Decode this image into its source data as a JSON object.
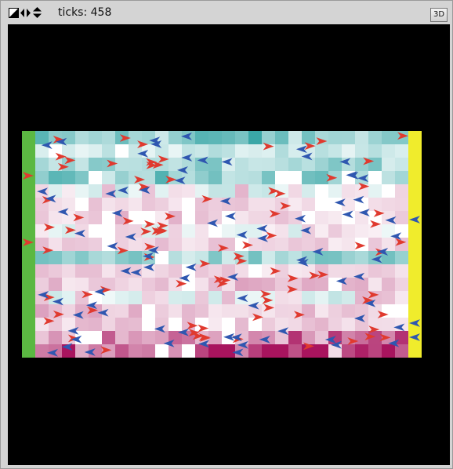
{
  "toolbar": {
    "ticks_text": "ticks: 458",
    "view_3d_label": "3D"
  },
  "icons": {
    "corner": "resize-corner-icon",
    "lr": "left-right-arrows-icon",
    "ud": "up-down-arrows-icon"
  },
  "colors": {
    "background": "#000000",
    "left_exit": "#5bb842",
    "right_exit": "#f0ec2c",
    "red_agents": "#e03a2f",
    "blue_agents": "#2f57b0",
    "teal_strong": "#3aa7a7",
    "teal_light": "#d4f1f1",
    "pink_strong": "#a8145e",
    "pink_light": "#f5dbe6"
  },
  "grid": {
    "cols": 28,
    "rows": 17,
    "left_exit_rows": "all",
    "right_exit_rows": "all"
  }
}
